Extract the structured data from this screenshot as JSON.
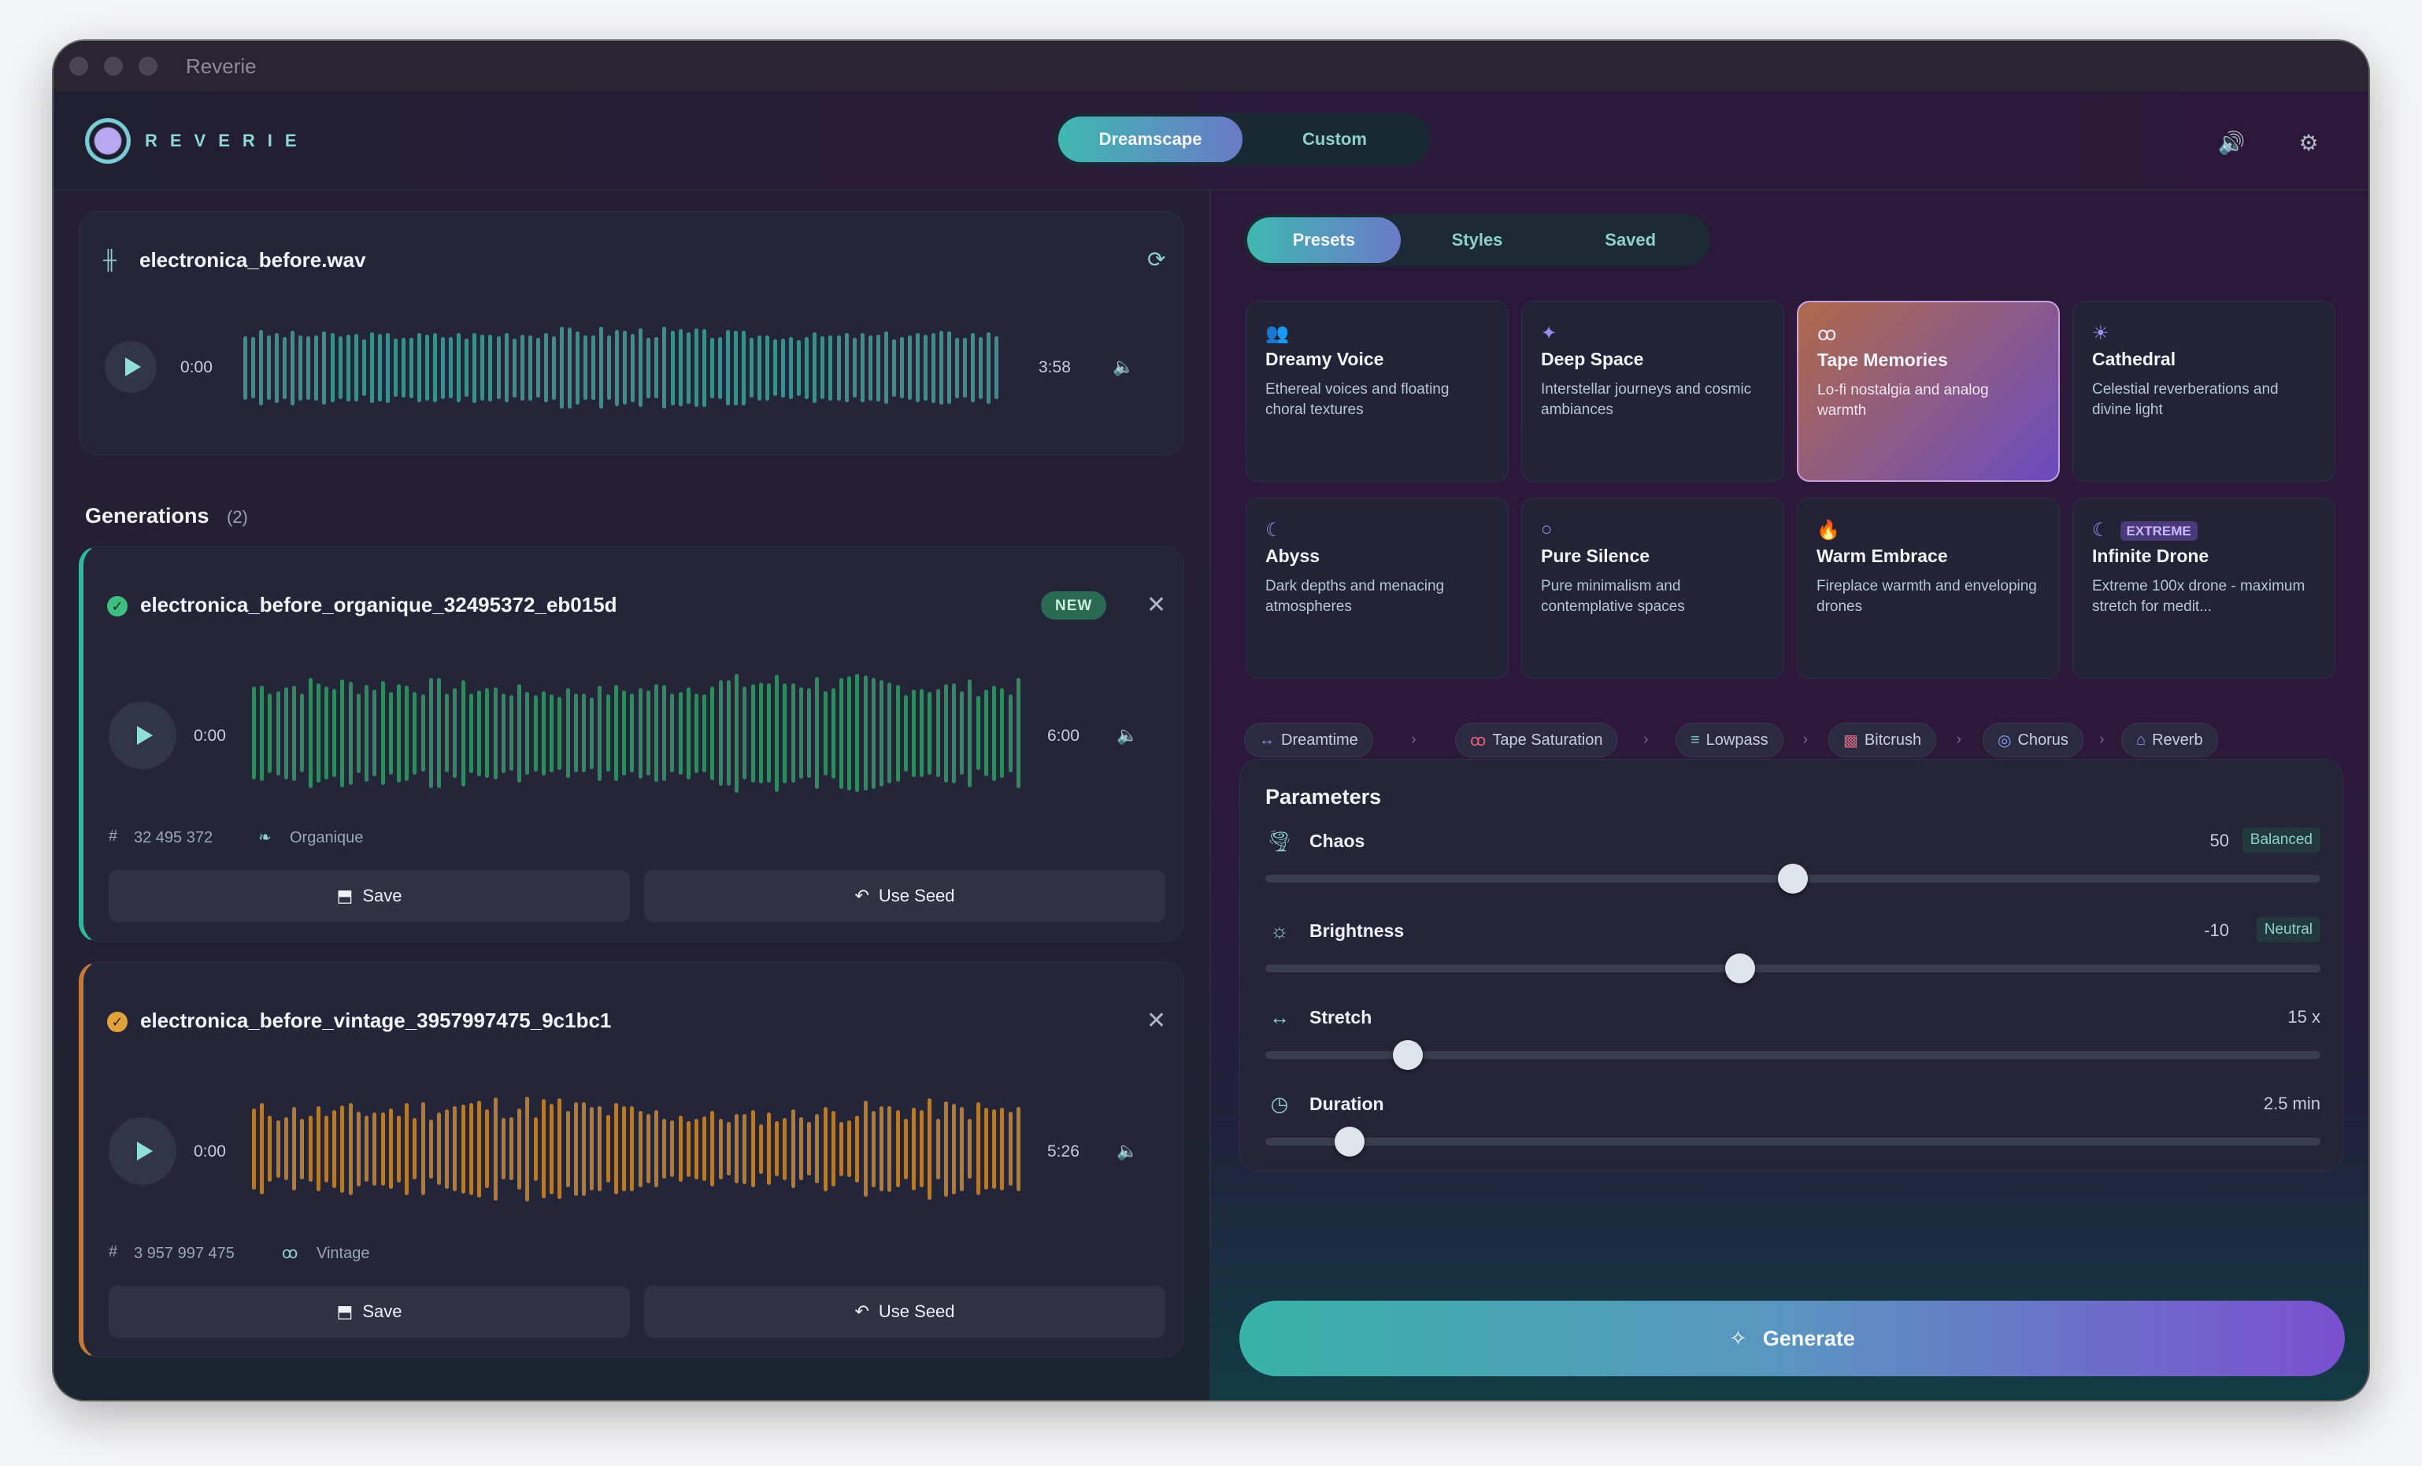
{
  "window": {
    "title": "Reverie"
  },
  "brand": {
    "name": "REVERIE"
  },
  "mode_tabs": [
    {
      "label": "Dreamscape",
      "active": true
    },
    {
      "label": "Custom",
      "active": false
    }
  ],
  "source": {
    "filename": "electronica_before.wav",
    "time": "0:00",
    "duration": "3:58",
    "wave_color": "#3a8f8c"
  },
  "generations": {
    "title": "Generations",
    "count": "(2)",
    "items": [
      {
        "filename": "electronica_before_organique_32495372_eb015d",
        "badge": "NEW",
        "time": "0:00",
        "duration": "6:00",
        "seed": "32 495 372",
        "style": "Organique",
        "save_label": "Save",
        "seed_label": "Use Seed",
        "wave_color": "#2f8a5e",
        "accent": "#2fb89a",
        "check_color": "#3fbf7f"
      },
      {
        "filename": "electronica_before_vintage_3957997475_9c1bc1",
        "badge": "",
        "time": "0:00",
        "duration": "5:26",
        "seed": "3 957 997 475",
        "style": "Vintage",
        "save_label": "Save",
        "seed_label": "Use Seed",
        "wave_color": "#b47a2e",
        "accent": "#c67a3a",
        "check_color": "#e0a33a"
      }
    ]
  },
  "preset_tabs": [
    {
      "label": "Presets",
      "active": true
    },
    {
      "label": "Styles",
      "active": false
    },
    {
      "label": "Saved",
      "active": false
    }
  ],
  "presets": [
    {
      "icon": "👥",
      "title": "Dreamy Voice",
      "desc": "Ethereal voices and floating choral textures",
      "selected": false,
      "badge": ""
    },
    {
      "icon": "✦",
      "title": "Deep Space",
      "desc": "Interstellar journeys and cosmic ambiances",
      "selected": false,
      "badge": ""
    },
    {
      "icon": "ꝏ",
      "title": "Tape Memories",
      "desc": "Lo-fi nostalgia and analog warmth",
      "selected": true,
      "badge": ""
    },
    {
      "icon": "☀",
      "title": "Cathedral",
      "desc": "Celestial reverberations and divine light",
      "selected": false,
      "badge": ""
    },
    {
      "icon": "☾",
      "title": "Abyss",
      "desc": "Dark depths and menacing atmospheres",
      "selected": false,
      "badge": ""
    },
    {
      "icon": "○",
      "title": "Pure Silence",
      "desc": "Pure minimalism and contemplative spaces",
      "selected": false,
      "badge": ""
    },
    {
      "icon": "🔥",
      "title": "Warm Embrace",
      "desc": "Fireplace warmth and enveloping drones",
      "selected": false,
      "badge": ""
    },
    {
      "icon": "☾",
      "title": "Infinite Drone",
      "desc": "Extreme 100x drone - maximum stretch for medit...",
      "selected": false,
      "badge": "EXTREME"
    }
  ],
  "chain": [
    {
      "icon": "↔",
      "label": "Dreamtime",
      "color": "#9c8cf2"
    },
    {
      "icon": "ꝏ",
      "label": "Tape Saturation",
      "color": "#e0607a"
    },
    {
      "icon": "≡",
      "label": "Lowpass",
      "color": "#7fc9c4"
    },
    {
      "icon": "▩",
      "label": "Bitcrush",
      "color": "#e0607a"
    },
    {
      "icon": "◎",
      "label": "Chorus",
      "color": "#8a9cf2"
    },
    {
      "icon": "⌂",
      "label": "Reverb",
      "color": "#8a9cf2"
    }
  ],
  "parameters": {
    "title": "Parameters",
    "items": [
      {
        "icon": "🌪",
        "label": "Chaos",
        "value": "50",
        "tag": "Balanced",
        "level": 0.5
      },
      {
        "icon": "☼",
        "label": "Brightness",
        "value": "-10",
        "tag": "Neutral",
        "level": 0.45
      },
      {
        "icon": "↔",
        "label": "Stretch",
        "value": "15 x",
        "tag": "",
        "level": 0.135
      },
      {
        "icon": "◷",
        "label": "Duration",
        "value": "2.5 min",
        "tag": "",
        "level": 0.08
      }
    ]
  },
  "generate_label": "Generate"
}
